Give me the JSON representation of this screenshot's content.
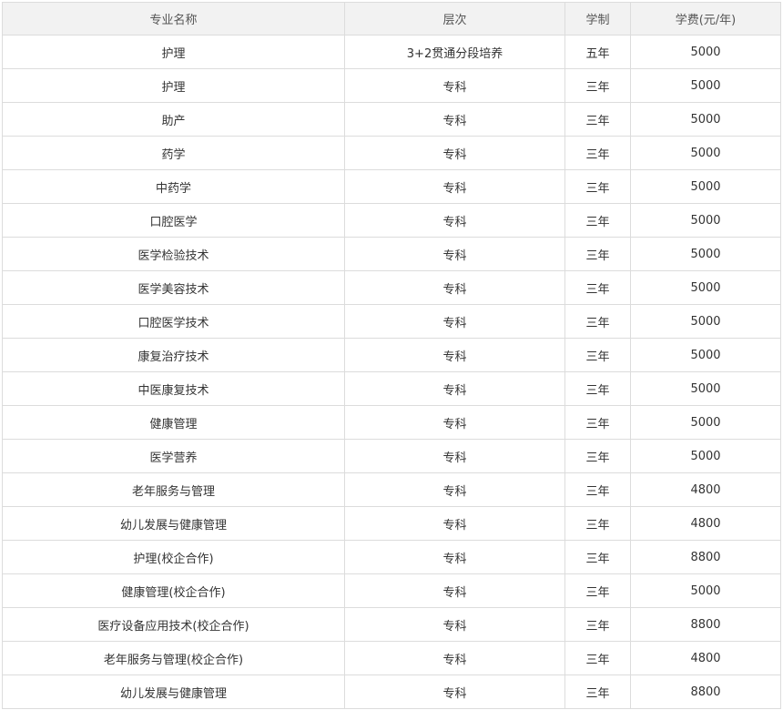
{
  "table": {
    "headers": [
      "专业名称",
      "层次",
      "学制",
      "学费(元/年)"
    ],
    "rows": [
      [
        "护理",
        "3+2贯通分段培养",
        "五年",
        "5000"
      ],
      [
        "护理",
        "专科",
        "三年",
        "5000"
      ],
      [
        "助产",
        "专科",
        "三年",
        "5000"
      ],
      [
        "药学",
        "专科",
        "三年",
        "5000"
      ],
      [
        "中药学",
        "专科",
        "三年",
        "5000"
      ],
      [
        "口腔医学",
        "专科",
        "三年",
        "5000"
      ],
      [
        "医学检验技术",
        "专科",
        "三年",
        "5000"
      ],
      [
        "医学美容技术",
        "专科",
        "三年",
        "5000"
      ],
      [
        "口腔医学技术",
        "专科",
        "三年",
        "5000"
      ],
      [
        "康复治疗技术",
        "专科",
        "三年",
        "5000"
      ],
      [
        "中医康复技术",
        "专科",
        "三年",
        "5000"
      ],
      [
        "健康管理",
        "专科",
        "三年",
        "5000"
      ],
      [
        "医学营养",
        "专科",
        "三年",
        "5000"
      ],
      [
        "老年服务与管理",
        "专科",
        "三年",
        "4800"
      ],
      [
        "幼儿发展与健康管理",
        "专科",
        "三年",
        "4800"
      ],
      [
        "护理(校企合作)",
        "专科",
        "三年",
        "8800"
      ],
      [
        "健康管理(校企合作)",
        "专科",
        "三年",
        "5000"
      ],
      [
        "医疗设备应用技术(校企合作)",
        "专科",
        "三年",
        "8800"
      ],
      [
        "老年服务与管理(校企合作)",
        "专科",
        "三年",
        "4800"
      ],
      [
        "幼儿发展与健康管理",
        "专科",
        "三年",
        "8800"
      ]
    ]
  },
  "colors": {
    "header_bg": "#f2f2f2",
    "border": "#dcdcdc",
    "text": "#333333"
  }
}
